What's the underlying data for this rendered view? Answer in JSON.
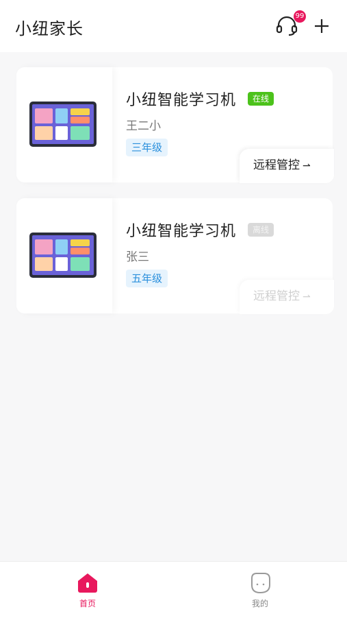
{
  "header": {
    "title": "小纽家长",
    "support_badge": "99"
  },
  "devices": [
    {
      "name": "小纽智能学习机",
      "status": "在线",
      "status_color": "#4cc21b",
      "student": "王二小",
      "grade": "三年级",
      "remote_label": "远程管控",
      "remote_enabled": true
    },
    {
      "name": "小纽智能学习机",
      "status": "离线",
      "status_color": "#d9d9d9",
      "student": "张三",
      "grade": "五年级",
      "remote_label": "远程管控",
      "remote_enabled": false
    }
  ],
  "tabbar": {
    "home_label": "首页",
    "mine_label": "我的",
    "active_color": "#e8185d"
  },
  "icons": {
    "support": "headset-icon",
    "add": "plus-icon",
    "home": "home-icon",
    "mine": "profile-face-icon",
    "remote": "arrow-right-icon"
  }
}
